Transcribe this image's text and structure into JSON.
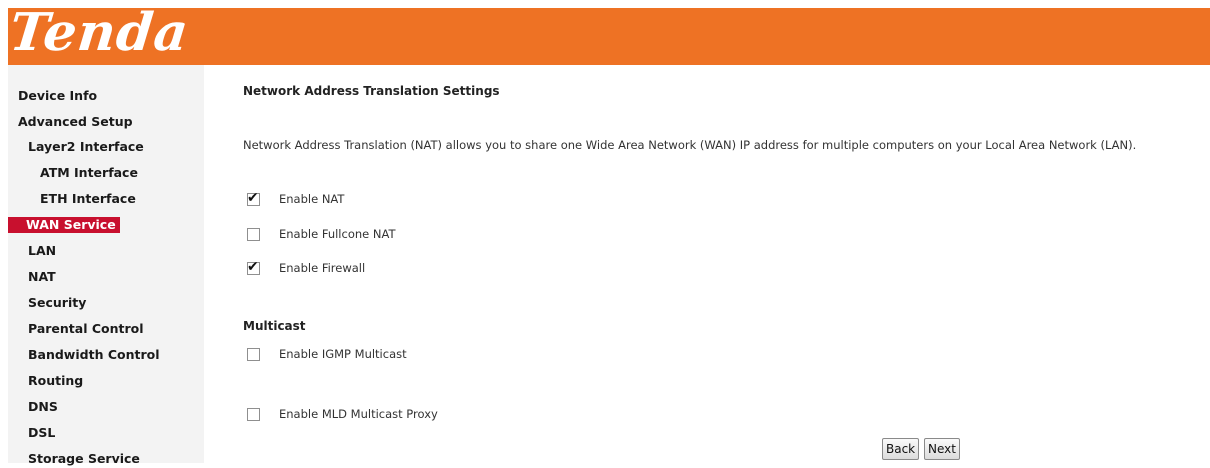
{
  "header": {
    "logo_text": "Tenda",
    "brand_color": "#ee7224"
  },
  "sidebar": {
    "items": [
      {
        "label": "Device Info"
      },
      {
        "label": "Advanced Setup"
      },
      {
        "label": "Layer2 Interface"
      },
      {
        "label": "ATM Interface"
      },
      {
        "label": "ETH Interface"
      },
      {
        "label": "WAN Service",
        "active": true
      },
      {
        "label": "LAN"
      },
      {
        "label": "NAT"
      },
      {
        "label": "Security"
      },
      {
        "label": "Parental Control"
      },
      {
        "label": "Bandwidth Control"
      },
      {
        "label": "Routing"
      },
      {
        "label": "DNS"
      },
      {
        "label": "DSL"
      },
      {
        "label": "Storage Service"
      }
    ],
    "active_color": "#c8102e"
  },
  "main": {
    "title": "Network Address Translation Settings",
    "description": "Network Address Translation (NAT) allows you to share one Wide Area Network (WAN) IP address for multiple computers on your Local Area Network (LAN).",
    "options": [
      {
        "label": "Enable NAT",
        "checked": true
      },
      {
        "label": "Enable Fullcone NAT",
        "checked": false
      },
      {
        "label": "Enable Firewall",
        "checked": true
      }
    ],
    "multicast": {
      "title": "Multicast",
      "options": [
        {
          "label": "Enable IGMP Multicast",
          "checked": false
        },
        {
          "label": "Enable MLD Multicast Proxy",
          "checked": false
        }
      ]
    },
    "buttons": {
      "back": "Back",
      "next": "Next"
    }
  }
}
